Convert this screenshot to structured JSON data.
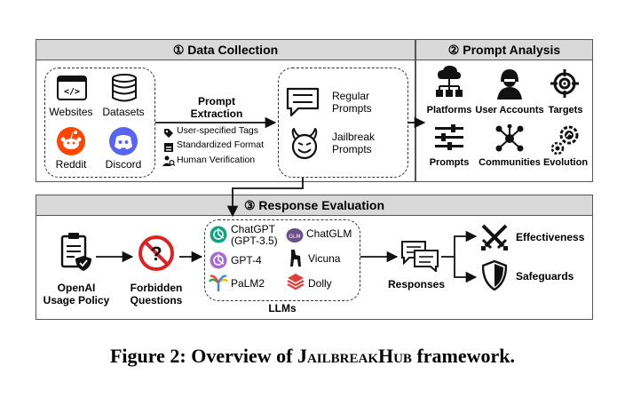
{
  "panels": {
    "data_collection": "① Data Collection",
    "prompt_analysis": "② Prompt Analysis",
    "response_evaluation": "③ Response Evaluation"
  },
  "sources": [
    "Websites",
    "Datasets",
    "Reddit",
    "Discord"
  ],
  "extraction": {
    "title_line1": "Prompt",
    "title_line2": "Extraction",
    "steps": [
      "User-specified Tags",
      "Standardized Format",
      "Human Verification"
    ]
  },
  "prompt_types": {
    "regular_line1": "Regular",
    "regular_line2": "Prompts",
    "jailbreak_line1": "Jailbreak",
    "jailbreak_line2": "Prompts"
  },
  "analysis_items": [
    "Platforms",
    "User Accounts",
    "Targets",
    "Prompts",
    "Communities",
    "Evolution"
  ],
  "evaluation": {
    "policy_line1": "OpenAI",
    "policy_line2": "Usage Policy",
    "questions_line1": "Forbidden",
    "questions_line2": "Questions",
    "llms_label": "LLMs",
    "llms": {
      "chatgpt_line1": "ChatGPT",
      "chatgpt_line2": "(GPT-3.5)",
      "chatglm": "ChatGLM",
      "gpt4": "GPT-4",
      "vicuna": "Vicuna",
      "palm2": "PaLM2",
      "dolly": "Dolly"
    },
    "responses": "Responses",
    "outcomes": [
      "Effectiveness",
      "Safeguards"
    ]
  },
  "caption": {
    "prefix": "Figure 2: Overview of ",
    "name": "JailbreakHub",
    "suffix": " framework."
  },
  "colors": {
    "reddit": "#ff4500",
    "discord": "#5865f2",
    "openai_green": "#10a37f",
    "openai_purple": "#a56bd6",
    "dolly_red": "#e03d3d",
    "forbidden_red": "#e02020",
    "panel_header": "#d9d9d9"
  }
}
